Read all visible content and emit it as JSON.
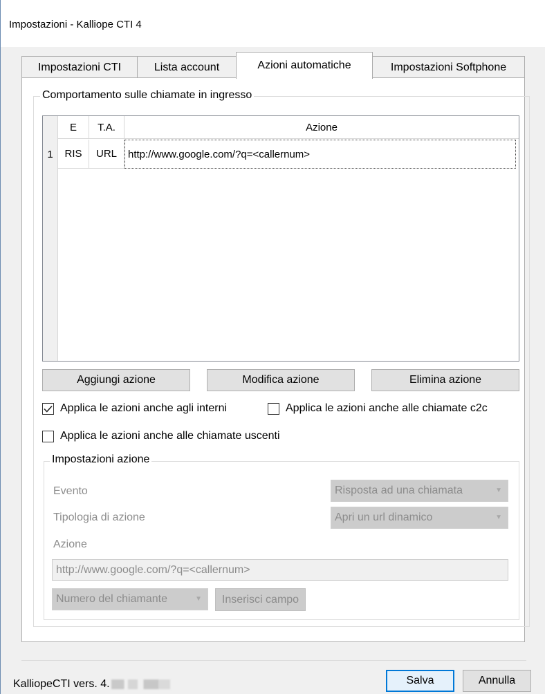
{
  "window": {
    "title": "Impostazioni - Kalliope CTI 4"
  },
  "tabs": [
    {
      "label": "Impostazioni CTI"
    },
    {
      "label": "Lista account"
    },
    {
      "label": "Azioni automatiche"
    },
    {
      "label": "Impostazioni Softphone"
    }
  ],
  "incoming": {
    "group_title": "Comportamento sulle chiamate in ingresso",
    "table": {
      "columns": [
        "E",
        "T.A.",
        "Azione"
      ],
      "rows": [
        {
          "num": "1",
          "event": "RIS",
          "type": "URL",
          "action": "http://www.google.com/?q=<callernum>"
        }
      ]
    },
    "buttons": {
      "add": "Aggiungi azione",
      "edit": "Modifica azione",
      "delete": "Elimina azione"
    },
    "options": {
      "internal": {
        "label": "Applica le azioni anche agli interni",
        "checked": true
      },
      "c2c": {
        "label": "Applica le azioni anche alle chiamate c2c",
        "checked": false
      },
      "outgoing": {
        "label": "Applica le azioni anche alle chiamate uscenti",
        "checked": false
      }
    }
  },
  "action_settings": {
    "group_title": "Impostazioni azione",
    "event_label": "Evento",
    "event_value": "Risposta ad una chiamata",
    "type_label": "Tipologia di azione",
    "type_value": "Apri un url dinamico",
    "action_label": "Azione",
    "action_value": "http://www.google.com/?q=<callernum>",
    "field_value": "Numero del chiamante",
    "insert_field": "Inserisci campo"
  },
  "footer": {
    "version": "KalliopeCTI vers. 4.",
    "save": "Salva",
    "cancel": "Annulla"
  },
  "icons": {
    "check": "check-icon",
    "dropdown": "chevron-down-icon"
  }
}
